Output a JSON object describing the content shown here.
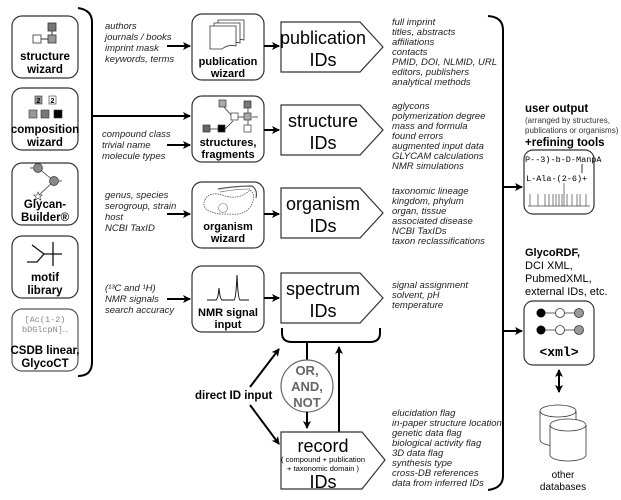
{
  "input_tools": [
    {
      "label_lines": [
        "structure",
        "wizard"
      ],
      "icon": "structure-icon"
    },
    {
      "label_lines": [
        "composition",
        "wizard"
      ],
      "icon": "composition-icon",
      "icon_numbers": [
        "2",
        "2"
      ]
    },
    {
      "label_lines": [
        "Glycan-",
        "Builder®"
      ],
      "icon": "glycan-builder-icon"
    },
    {
      "label_lines": [
        "motif",
        "library"
      ],
      "icon": "motif-icon"
    },
    {
      "label_lines": [
        "CSDB linear,",
        "GlycoCT"
      ],
      "icon": "linear-code-icon",
      "code_lines": [
        "[Ac(1-2)",
        "bDGlcpN]…"
      ]
    }
  ],
  "query_inputs": [
    {
      "id": "publication",
      "params": [
        "authors",
        "journals / books",
        "imprint mask",
        "keywords, terms"
      ],
      "wizard_lines": [
        "publication",
        "wizard"
      ],
      "ids_lines": [
        "publication",
        "IDs"
      ],
      "details": [
        "full imprint",
        "titles, abstracts",
        "affiliations",
        "contacts",
        "PMID, DOI, NLMID, URL",
        "editors, publishers",
        "analytical methods"
      ]
    },
    {
      "id": "structure",
      "params": [
        "compound class",
        "trivial name",
        "molecule types"
      ],
      "wizard_lines": [
        "structures,",
        "fragments"
      ],
      "ids_lines": [
        "structure",
        "IDs"
      ],
      "details": [
        "aglycons",
        "polymerization degree",
        "mass and formula",
        "found errors",
        "augmented input data",
        "GLYCAM calculations",
        "NMR simulations"
      ]
    },
    {
      "id": "organism",
      "params": [
        "genus, species",
        "serogroup, strain",
        "host",
        "NCBI TaxID"
      ],
      "wizard_lines": [
        "organism",
        "wizard"
      ],
      "ids_lines": [
        "organism",
        "IDs"
      ],
      "details": [
        "taxonomic lineage",
        "kingdom, phylum",
        "organ, tissue",
        "associated disease",
        "NCBI TaxIDs",
        "taxon reclassifications"
      ]
    },
    {
      "id": "spectrum",
      "params": [
        "(¹³C and ¹H)",
        "NMR signals",
        "search accuracy"
      ],
      "wizard_lines": [
        "NMR signal",
        "input"
      ],
      "ids_lines": [
        "spectrum",
        "IDs"
      ],
      "details": [
        "signal assignment",
        "solvent, pH",
        "temperature"
      ]
    }
  ],
  "logic": {
    "lines": [
      "OR,",
      "AND,",
      "NOT"
    ]
  },
  "direct_input": "direct ID input",
  "record": {
    "title": "record",
    "sub_lines": [
      "( compound + publication",
      "+ taxonomic domain )"
    ],
    "ids": "IDs",
    "details": [
      "elucidation flag",
      "in-paper  structure location",
      "genetic data flag",
      "biological activity flag",
      "3D data flag",
      "synthesis type",
      "cross-DB references",
      "data from inferred IDs"
    ]
  },
  "user_output": {
    "title": "user output",
    "subtitle_lines": [
      "(arranged by structures,",
      "publications or organisms)"
    ],
    "tools": "+refining tools",
    "snippet_lines": [
      "P--3)-b-D-ManpA",
      "L-Ala-(2-6)+"
    ]
  },
  "export": {
    "title": "GlycoRDF,",
    "lines": [
      "DCI XML,",
      "PubmedXML,",
      "external IDs, etc."
    ],
    "xml_label": "<xml>"
  },
  "databases": {
    "lines": [
      "other",
      "databases"
    ]
  }
}
